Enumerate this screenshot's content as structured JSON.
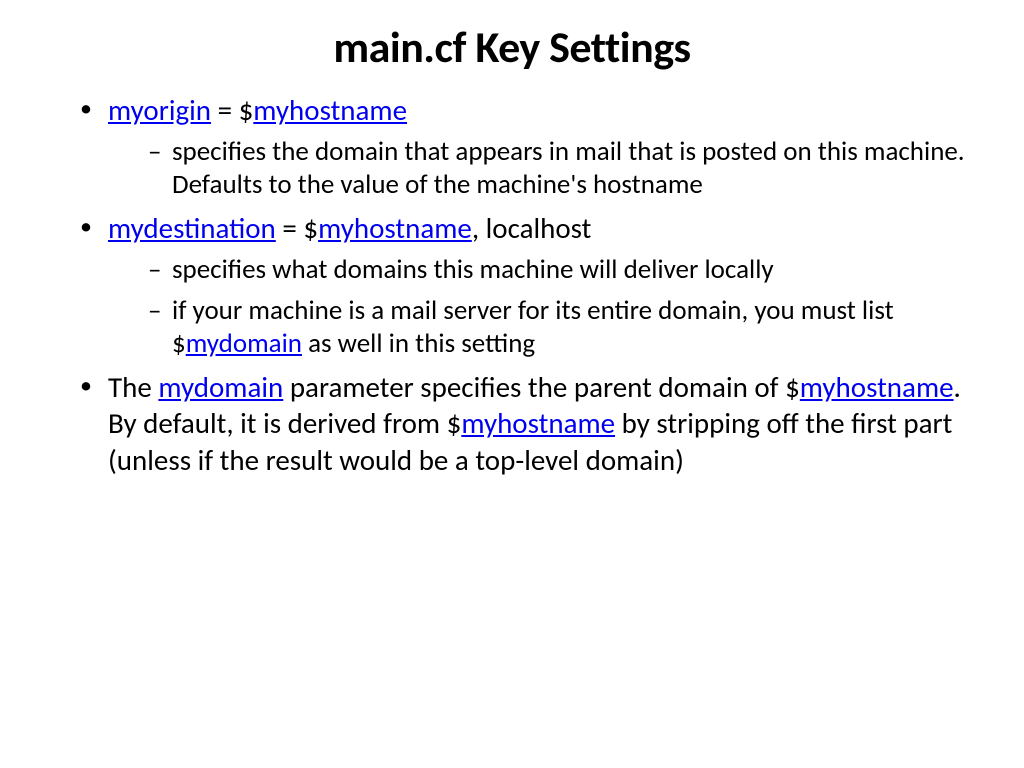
{
  "title": "main.cf Key Settings",
  "links": {
    "myorigin": "myorigin",
    "myhostname": "myhostname",
    "mydestination": "mydestination",
    "mydomain": "mydomain"
  },
  "items": {
    "item1_equals": " = $",
    "item1_sub1": "specifies the domain that appears in mail that is posted on this machine. Defaults to the value of the machine's hostname",
    "item2_equals": " = $",
    "item2_suffix": ", localhost",
    "item2_sub1": "specifies what domains this machine will deliver locally",
    "item2_sub2a": "if your machine is a mail server for its entire domain, you must list $",
    "item2_sub2b": " as well in this setting",
    "item3a": "The ",
    "item3b": " parameter specifies the parent domain of $",
    "item3c": ". By default, it is derived from $",
    "item3d": " by stripping off the first part (unless if the result would be a top-level domain)"
  }
}
